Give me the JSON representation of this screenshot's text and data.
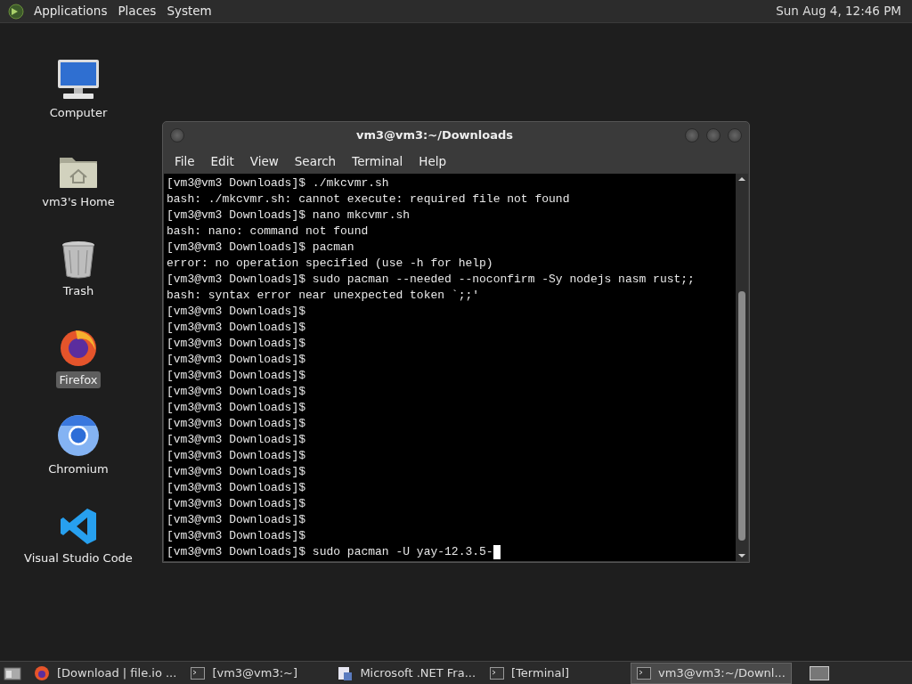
{
  "top_panel": {
    "menus": [
      "Applications",
      "Places",
      "System"
    ],
    "clock": "Sun Aug  4, 12:46 PM"
  },
  "desktop_icons": [
    {
      "kind": "computer",
      "label": "Computer",
      "selected": false
    },
    {
      "kind": "home",
      "label": "vm3's Home",
      "selected": false
    },
    {
      "kind": "trash",
      "label": "Trash",
      "selected": false
    },
    {
      "kind": "firefox",
      "label": "Firefox",
      "selected": true
    },
    {
      "kind": "chromium",
      "label": "Chromium",
      "selected": false
    },
    {
      "kind": "vscode",
      "label": "Visual Studio Code",
      "selected": false
    }
  ],
  "terminal": {
    "title": "vm3@vm3:~/Downloads",
    "menu": [
      "File",
      "Edit",
      "View",
      "Search",
      "Terminal",
      "Help"
    ],
    "lines": [
      "[vm3@vm3 Downloads]$ ./mkcvmr.sh",
      "bash: ./mkcvmr.sh: cannot execute: required file not found",
      "[vm3@vm3 Downloads]$ nano mkcvmr.sh",
      "bash: nano: command not found",
      "[vm3@vm3 Downloads]$ pacman",
      "error: no operation specified (use -h for help)",
      "[vm3@vm3 Downloads]$ sudo pacman --needed --noconfirm -Sy nodejs nasm rust;;",
      "bash: syntax error near unexpected token `;;'",
      "[vm3@vm3 Downloads]$",
      "[vm3@vm3 Downloads]$",
      "[vm3@vm3 Downloads]$",
      "[vm3@vm3 Downloads]$",
      "[vm3@vm3 Downloads]$",
      "[vm3@vm3 Downloads]$",
      "[vm3@vm3 Downloads]$",
      "[vm3@vm3 Downloads]$",
      "[vm3@vm3 Downloads]$",
      "[vm3@vm3 Downloads]$",
      "[vm3@vm3 Downloads]$",
      "[vm3@vm3 Downloads]$",
      "[vm3@vm3 Downloads]$",
      "[vm3@vm3 Downloads]$",
      "[vm3@vm3 Downloads]$",
      "[vm3@vm3 Downloads]$ sudo pacman -U yay-12.3.5-"
    ]
  },
  "taskbar": [
    {
      "kind": "firefox",
      "label": "[Download | file.io ...",
      "selected": false
    },
    {
      "kind": "terminal",
      "label": "[vm3@vm3:~]",
      "selected": false
    },
    {
      "kind": "installer",
      "label": "Microsoft .NET Fra...",
      "selected": false
    },
    {
      "kind": "terminal",
      "label": "[Terminal]",
      "selected": false
    },
    {
      "kind": "terminal",
      "label": "vm3@vm3:~/Downl...",
      "selected": true
    }
  ]
}
